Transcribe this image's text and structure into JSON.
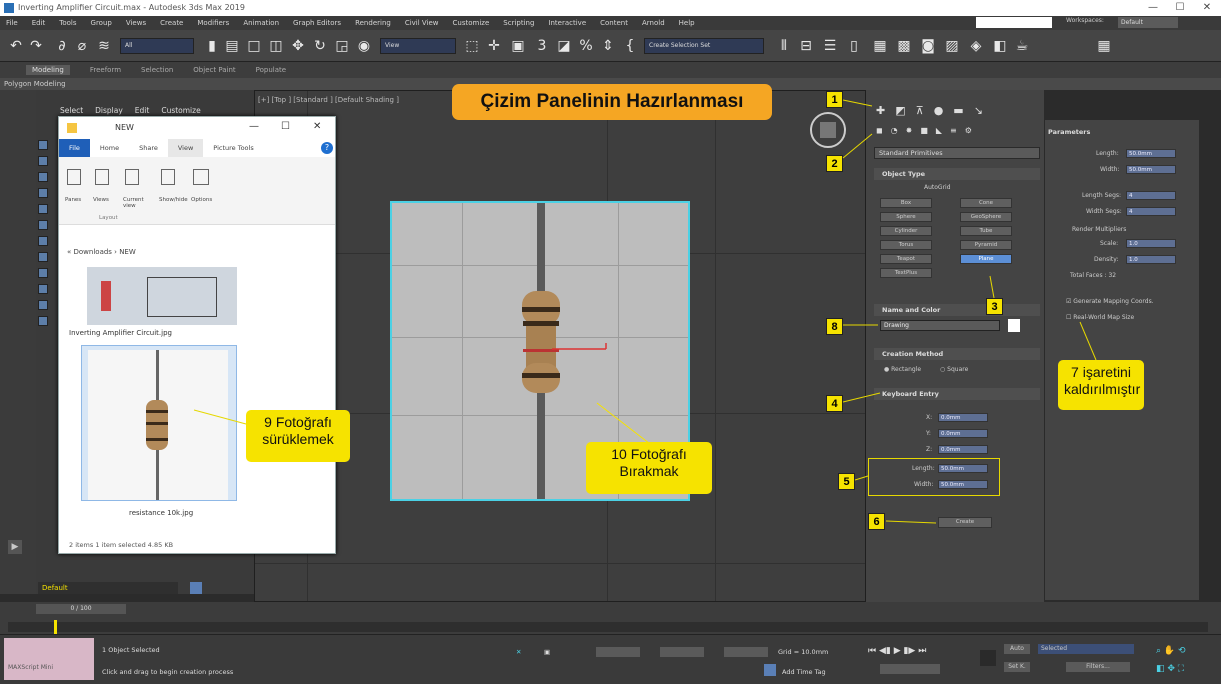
{
  "window": {
    "title": "Inverting Amplifier Circuit.max - Autodesk 3ds Max 2019",
    "min": "—",
    "max": "☐",
    "close": "✕"
  },
  "menubar": [
    "File",
    "Edit",
    "Tools",
    "Group",
    "Views",
    "Create",
    "Modifiers",
    "Animation",
    "Graph Editors",
    "Rendering",
    "Civil View",
    "Customize",
    "Scripting",
    "Interactive",
    "Content",
    "Arnold",
    "Help"
  ],
  "workspace": {
    "label": "Workspaces:",
    "value": "Default"
  },
  "toolbar": {
    "filter": "All",
    "view": "View",
    "selection_set": "Create Selection Set"
  },
  "ribbon": {
    "tabs": [
      "Modeling",
      "Freeform",
      "Selection",
      "Object Paint",
      "Populate"
    ],
    "sub": "Polygon Modeling"
  },
  "scene_explorer": {
    "menu": [
      "Select",
      "Display",
      "Edit",
      "Customize"
    ],
    "layer": "Default"
  },
  "viewport": {
    "label": "[+] [Top ] [Standard ] [Default Shading ]"
  },
  "explorer": {
    "title": "NEW",
    "tabs": [
      "File",
      "Home",
      "Share",
      "View",
      "Picture Tools"
    ],
    "ribbon_items": [
      "Panes",
      "Views",
      "Current view",
      "Show/hide",
      "Options"
    ],
    "ribbon_group": "Layout",
    "address": "« Downloads › NEW",
    "file1": "Inverting Amplifier Circuit.jpg",
    "file2": "resistance 10k.jpg",
    "status": "2 items   1 item selected  4.85 KB"
  },
  "annotations": {
    "title": "Çizim Panelinin Hazırlanması",
    "n1": "1",
    "n2": "2",
    "n3": "3",
    "n4": "4",
    "n5": "5",
    "n6": "6",
    "n8": "8",
    "c7": "7 işaretini kaldırılmıştır",
    "c9": "9 Fotoğrafı sürüklemek",
    "c10": "10 Fotoğrafı Bırakmak"
  },
  "command_panel": {
    "dropdown": "Standard Primitives",
    "object_type": "Object Type",
    "autogrid": "AutoGrid",
    "buttons": [
      "Box",
      "Cone",
      "Sphere",
      "GeoSphere",
      "Cylinder",
      "Tube",
      "Torus",
      "Pyramid",
      "Teapot",
      "Plane",
      "TextPlus"
    ],
    "selected": "Plane",
    "name_color": "Name and Color",
    "name_value": "Drawing",
    "creation": "Creation Method",
    "rect": "Rectangle",
    "square": "Square",
    "keyboard": "Keyboard Entry",
    "x": "X:",
    "x_v": "0.0mm",
    "y": "Y:",
    "y_v": "0.0mm",
    "z": "Z:",
    "z_v": "0.0mm",
    "length": "Length:",
    "length_v": "50.0mm",
    "width": "Width:",
    "width_v": "50.0mm",
    "create": "Create"
  },
  "parameters": {
    "title": "Parameters",
    "length": "Length:",
    "length_v": "50.0mm",
    "width": "Width:",
    "width_v": "50.0mm",
    "lsegs": "Length Segs:",
    "lsegs_v": "4",
    "wsegs": "Width Segs:",
    "wsegs_v": "4",
    "render_mult": "Render Multipliers",
    "scale": "Scale:",
    "scale_v": "1.0",
    "density": "Density:",
    "density_v": "1.0",
    "faces": "Total Faces : 32",
    "gen_map": "Generate Mapping Coords.",
    "real_world": "Real-World Map Size"
  },
  "timeline": {
    "slider": "0 / 100"
  },
  "status": {
    "selected": "1 Object Selected",
    "hint": "Click and drag to begin creation process",
    "grid": "Grid = 10.0mm",
    "add_time_tag": "Add Time Tag",
    "maxscript": "MAXScript Mini",
    "auto": "Auto",
    "selected_dd": "Selected",
    "set_k": "Set K.",
    "filters": "Filters..."
  },
  "colors": {
    "accent": "#f6e300",
    "title_callout": "#f5a623",
    "highlight": "#4bd1e5"
  }
}
